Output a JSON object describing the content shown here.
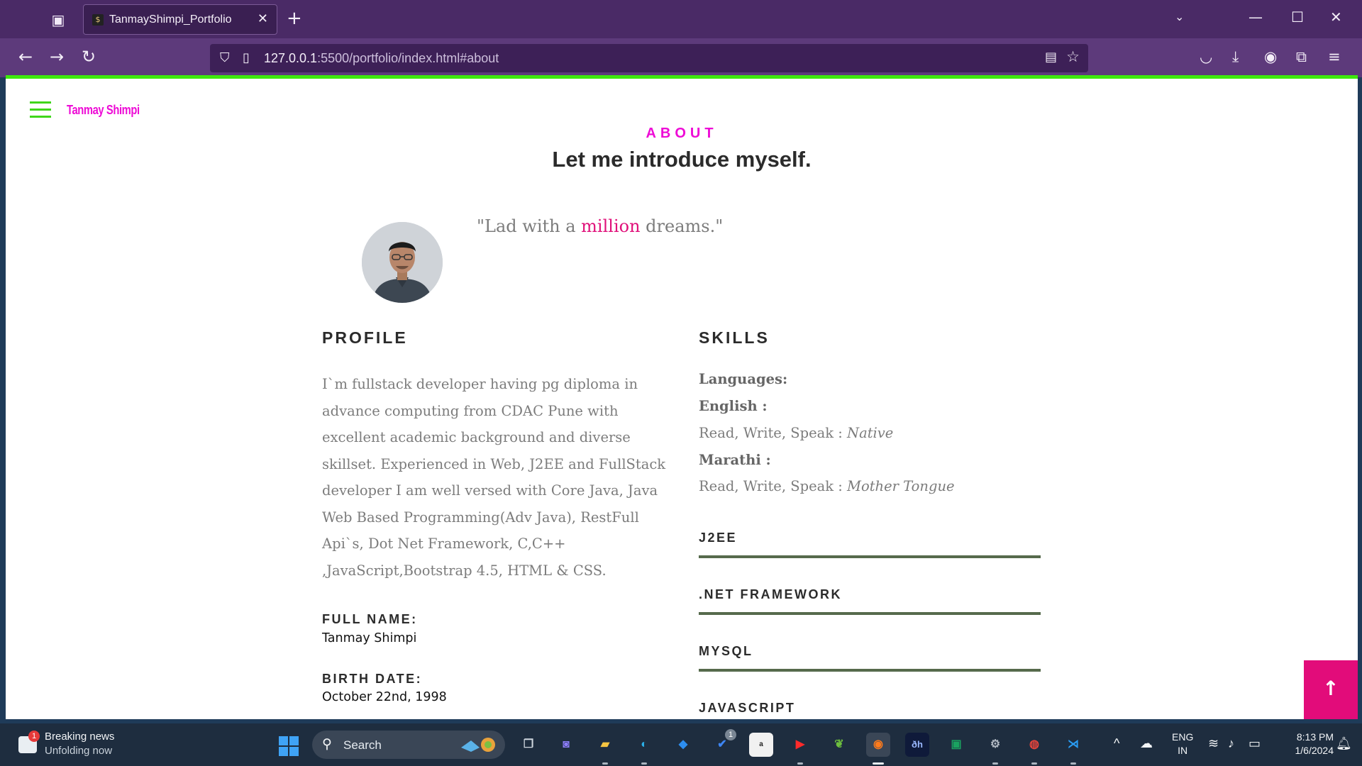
{
  "browser": {
    "tab_title": "TanmayShimpi_Portfolio",
    "url_host": "127.0.0.1",
    "url_rest": ":5500/portfolio/index.html#about"
  },
  "site": {
    "brand": "Tanmay Shimpi"
  },
  "about": {
    "kicker": "ABOUT",
    "title": "Let me introduce myself.",
    "quote_before": "\"Lad with a ",
    "quote_highlight": "million",
    "quote_after": " dreams.\""
  },
  "profile": {
    "heading": "PROFILE",
    "text": "I`m fullstack developer having pg diploma in advance computing from CDAC Pune with excellent academic background and diverse skillset. Experienced in Web, J2EE and FullStack developer I am well versed with Core Java, Java Web Based Programming(Adv Java), RestFull Api`s, Dot Net Framework, C,C++ ,JavaScript,Bootstrap 4.5, HTML & CSS.",
    "full_name_label": "FULL NAME:",
    "full_name_value": "Tanmay Shimpi",
    "birth_date_label": "BIRTH DATE:",
    "birth_date_value": "October 22nd, 1998"
  },
  "skills": {
    "heading": "SKILLS",
    "languages_label": "Languages:",
    "english_label": "English :",
    "english_prefix": "Read, Write, Speak : ",
    "english_level": "Native",
    "marathi_label": "Marathi :",
    "marathi_prefix": "Read, Write, Speak : ",
    "marathi_level": "Mother Tongue",
    "bars": [
      "J2EE",
      ".NET FRAMEWORK",
      "MYSQL",
      "JAVASCRIPT"
    ]
  },
  "back_to_top": "↑",
  "taskbar": {
    "news_title": "Breaking news",
    "news_sub": "Unfolding now",
    "news_badge": "1",
    "search_label": "Search",
    "todo_badge": "1",
    "lang_top": "ENG",
    "lang_bottom": "IN",
    "time": "8:13 PM",
    "date": "1/6/2024"
  },
  "colors": {
    "accent_magenta": "#ee0bd6",
    "accent_green": "#3ee80d",
    "back_to_top": "#e20c7a",
    "skill_bar": "#566a4c",
    "browser_purple": "#4a2a66"
  }
}
